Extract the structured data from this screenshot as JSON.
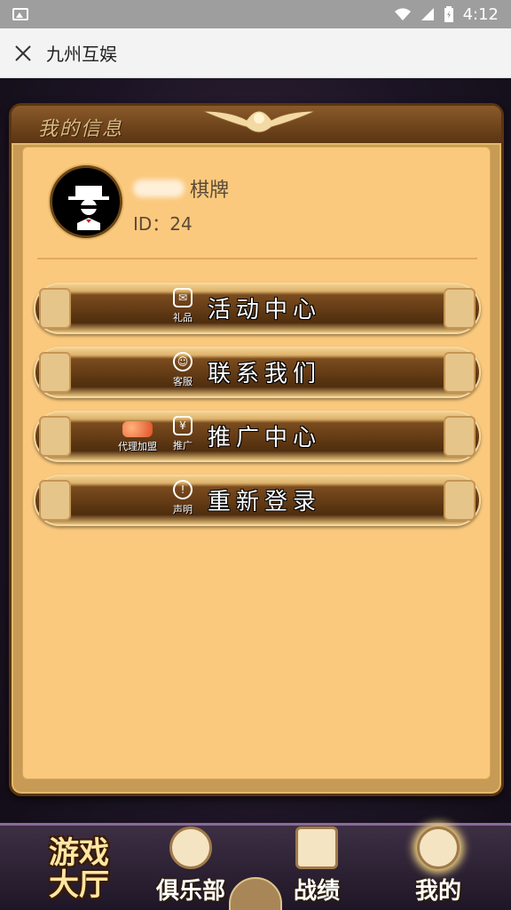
{
  "status_bar": {
    "time": "4:12",
    "icons": [
      "image-icon",
      "wifi-icon",
      "signal-icon",
      "battery-icon"
    ]
  },
  "title_bar": {
    "close_icon": "close-icon",
    "title": "九州互娱"
  },
  "panel": {
    "title": "我的信息"
  },
  "profile": {
    "name_suffix": "棋牌",
    "id_label": "ID：24"
  },
  "menu": [
    {
      "label": "活动中心",
      "icon": "gift-icon",
      "icon_caption": "礼品"
    },
    {
      "label": "联系我们",
      "icon": "customer-service-icon",
      "icon_caption": "客服"
    },
    {
      "label": "推广中心",
      "icon": "coins-icon",
      "icon_caption": "推广",
      "extra_caption": "代理加盟"
    },
    {
      "label": "重新登录",
      "icon": "warning-icon",
      "icon_caption": "声明"
    }
  ],
  "bottom_nav": {
    "lobby_line1": "游戏",
    "lobby_line2": "大厅",
    "club": "俱乐部",
    "records": "战绩",
    "mine": "我的"
  },
  "colors": {
    "panel_bg": "#fbc97d",
    "button_dark": "#4f2d0e",
    "status_bar": "#9e9e9e"
  }
}
